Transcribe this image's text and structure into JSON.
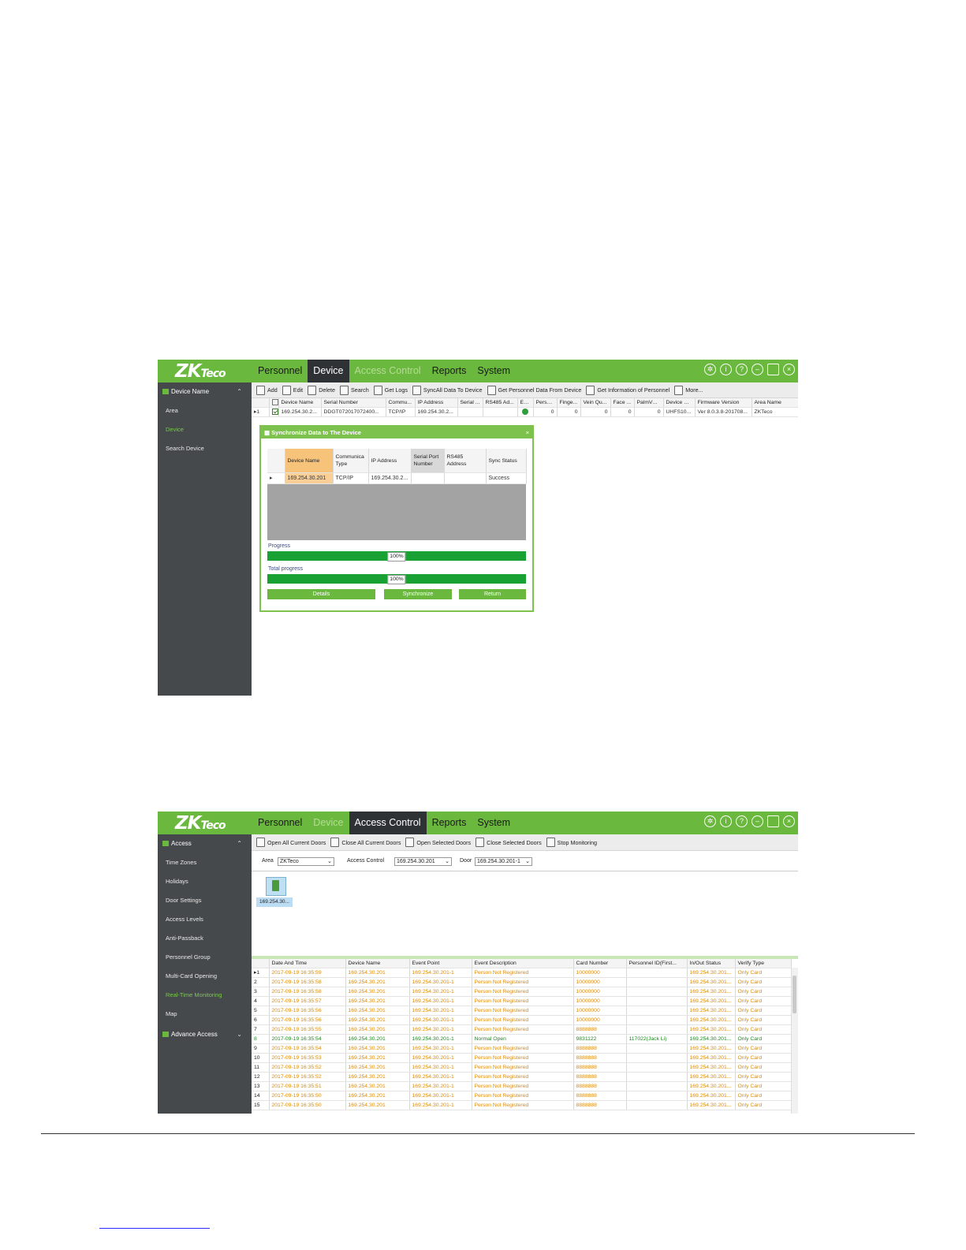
{
  "logo": "ZKTeco",
  "screen1": {
    "nav": [
      {
        "label": "Personnel",
        "state": "normal"
      },
      {
        "label": "Device",
        "state": "active"
      },
      {
        "label": "Access Control",
        "state": "muted"
      },
      {
        "label": "Reports",
        "state": "normal"
      },
      {
        "label": "System",
        "state": "normal"
      }
    ],
    "sidebar": {
      "section": "Device Name",
      "items": [
        {
          "label": "Area",
          "active": false
        },
        {
          "label": "Device",
          "active": true
        },
        {
          "label": "Search Device",
          "active": false
        }
      ]
    },
    "toolbar": [
      {
        "label": "Add",
        "icon": "add-icon"
      },
      {
        "label": "Edit",
        "icon": "edit-icon"
      },
      {
        "label": "Delete",
        "icon": "delete-icon"
      },
      {
        "label": "Search",
        "icon": "search-icon"
      },
      {
        "label": "Get Logs",
        "icon": "logs-icon"
      },
      {
        "label": "SyncAll Data To Device",
        "icon": "sync-icon"
      },
      {
        "label": "Get Personnel Data From Device",
        "icon": "download-icon"
      },
      {
        "label": "Get Information of Personnel",
        "icon": "person-icon"
      },
      {
        "label": "More...",
        "icon": "more-icon"
      }
    ],
    "device_table": {
      "headers": [
        "Device Name",
        "Serial Number",
        "Commu...",
        "IP Address",
        "Serial ...",
        "RS485 Ad...",
        "Ena...",
        "Perso...",
        "Finge...",
        "Vein Qu...",
        "Face ...",
        "PalmVei...",
        "Device M...",
        "Firmware Version",
        "Area Name"
      ],
      "rows": [
        {
          "index": "1",
          "cells": [
            "169.254.30.2...",
            "DDGT072017072400...",
            "TCP/IP",
            "169.254.30.2...",
            "",
            "",
            "",
            "0",
            "0",
            "0",
            "0",
            "0",
            "UHFS10...",
            "Ver 8.0.3.8-201708...",
            "ZKTeco"
          ]
        }
      ]
    },
    "dialog": {
      "title": "Synchronize Data to The Device",
      "close": "×",
      "headers": [
        "Device Name",
        "Communica Type",
        "IP Address",
        "Serial Port Number",
        "RS485 Address",
        "Sync Status"
      ],
      "rows": [
        [
          "169.254.30.201",
          "TCP/IP",
          "169.254.30.2...",
          "",
          "",
          "Success"
        ]
      ],
      "progress_label": "Progress",
      "progress_text": "100%",
      "progress_value": 1.0,
      "total_label": "Total progress",
      "total_text": "100%",
      "total_value": 1.0,
      "buttons": {
        "details": "Details",
        "synchronize": "Synchronize",
        "return": "Return"
      }
    }
  },
  "screen2": {
    "nav": [
      {
        "label": "Personnel",
        "state": "normal"
      },
      {
        "label": "Device",
        "state": "muted"
      },
      {
        "label": "Access Control",
        "state": "active"
      },
      {
        "label": "Reports",
        "state": "normal"
      },
      {
        "label": "System",
        "state": "normal"
      }
    ],
    "sidebar": {
      "section": "Access",
      "items": [
        {
          "label": "Time Zones",
          "active": false
        },
        {
          "label": "Holidays",
          "active": false
        },
        {
          "label": "Door Settings",
          "active": false
        },
        {
          "label": "Access Levels",
          "active": false
        },
        {
          "label": "Anti-Passback",
          "active": false
        },
        {
          "label": "Personnel Group",
          "active": false
        },
        {
          "label": "Multi-Card Opening",
          "active": false
        },
        {
          "label": "Real-Time Monitoring",
          "active": true
        },
        {
          "label": "Map",
          "active": false
        }
      ],
      "section2": "Advance Access"
    },
    "toolbar": [
      {
        "label": "Open All Current Doors",
        "icon": "door-open-icon"
      },
      {
        "label": "Close All Current Doors",
        "icon": "door-close-icon"
      },
      {
        "label": "Open Selected Doors",
        "icon": "door-open-icon"
      },
      {
        "label": "Close Selected Doors",
        "icon": "door-close-icon"
      },
      {
        "label": "Stop Monitoring",
        "icon": "monitor-icon"
      }
    ],
    "filter": {
      "area_label": "Area",
      "area_value": "ZKTeco",
      "access_label": "Access Control",
      "access_value": "169.254.30.201",
      "door_label": "Door",
      "door_value": "169.254.30.201-1"
    },
    "door_icon_label": "169.254.30...",
    "events": {
      "headers": [
        "Date And Time",
        "Device Name",
        "Event Point",
        "Event Description",
        "Card Number",
        "Personnel ID(First...",
        "In/Out Status",
        "Verify Type"
      ],
      "rows": [
        {
          "i": "1",
          "t": "2017-09-19 16:35:59",
          "d": "169.254.30.201",
          "p": "169.254.30.201-1",
          "e": "Person Not Registered",
          "c": "10000000",
          "pid": "",
          "s": "169.254.30.201...",
          "v": "Only Card",
          "g": false
        },
        {
          "i": "2",
          "t": "2017-09-19 16:35:58",
          "d": "169.254.30.201",
          "p": "169.254.30.201-1",
          "e": "Person Not Registered",
          "c": "10000000",
          "pid": "",
          "s": "169.254.30.201...",
          "v": "Only Card",
          "g": false
        },
        {
          "i": "3",
          "t": "2017-09-19 16:35:58",
          "d": "169.254.30.201",
          "p": "169.254.30.201-1",
          "e": "Person Not Registered",
          "c": "10000000",
          "pid": "",
          "s": "169.254.30.201...",
          "v": "Only Card",
          "g": false
        },
        {
          "i": "4",
          "t": "2017-09-19 16:35:57",
          "d": "169.254.30.201",
          "p": "169.254.30.201-1",
          "e": "Person Not Registered",
          "c": "10000000",
          "pid": "",
          "s": "169.254.30.201...",
          "v": "Only Card",
          "g": false
        },
        {
          "i": "5",
          "t": "2017-09-19 16:35:56",
          "d": "169.254.30.201",
          "p": "169.254.30.201-1",
          "e": "Person Not Registered",
          "c": "10000000",
          "pid": "",
          "s": "169.254.30.201...",
          "v": "Only Card",
          "g": false
        },
        {
          "i": "6",
          "t": "2017-09-19 16:35:56",
          "d": "169.254.30.201",
          "p": "169.254.30.201-1",
          "e": "Person Not Registered",
          "c": "10000000",
          "pid": "",
          "s": "169.254.30.201...",
          "v": "Only Card",
          "g": false
        },
        {
          "i": "7",
          "t": "2017-09-19 16:35:55",
          "d": "169.254.30.201",
          "p": "169.254.30.201-1",
          "e": "Person Not Registered",
          "c": "8888888",
          "pid": "",
          "s": "169.254.30.201...",
          "v": "Only Card",
          "g": false
        },
        {
          "i": "8",
          "t": "2017-09-19 16:35:54",
          "d": "169.254.30.201",
          "p": "169.254.30.201-1",
          "e": "Normal Open",
          "c": "9831122",
          "pid": "117022(Jack Li)",
          "s": "169.254.30.201...",
          "v": "Only Card",
          "g": true
        },
        {
          "i": "9",
          "t": "2017-09-19 16:35:54",
          "d": "169.254.30.201",
          "p": "169.254.30.201-1",
          "e": "Person Not Registered",
          "c": "8888888",
          "pid": "",
          "s": "169.254.30.201...",
          "v": "Only Card",
          "g": false
        },
        {
          "i": "10",
          "t": "2017-09-19 16:35:53",
          "d": "169.254.30.201",
          "p": "169.254.30.201-1",
          "e": "Person Not Registered",
          "c": "8888888",
          "pid": "",
          "s": "169.254.30.201...",
          "v": "Only Card",
          "g": false
        },
        {
          "i": "11",
          "t": "2017-09-19 16:35:52",
          "d": "169.254.30.201",
          "p": "169.254.30.201-1",
          "e": "Person Not Registered",
          "c": "8888888",
          "pid": "",
          "s": "169.254.30.201...",
          "v": "Only Card",
          "g": false
        },
        {
          "i": "12",
          "t": "2017-09-19 16:35:52",
          "d": "169.254.30.201",
          "p": "169.254.30.201-1",
          "e": "Person Not Registered",
          "c": "8888888",
          "pid": "",
          "s": "169.254.30.201...",
          "v": "Only Card",
          "g": false
        },
        {
          "i": "13",
          "t": "2017-09-19 16:35:51",
          "d": "169.254.30.201",
          "p": "169.254.30.201-1",
          "e": "Person Not Registered",
          "c": "8888888",
          "pid": "",
          "s": "169.254.30.201...",
          "v": "Only Card",
          "g": false
        },
        {
          "i": "14",
          "t": "2017-09-19 16:35:50",
          "d": "169.254.30.201",
          "p": "169.254.30.201-1",
          "e": "Person Not Registered",
          "c": "8888888",
          "pid": "",
          "s": "169.254.30.201...",
          "v": "Only Card",
          "g": false
        },
        {
          "i": "15",
          "t": "2017-09-19 16:35:50",
          "d": "169.254.30.201",
          "p": "169.254.30.201-1",
          "e": "Person Not Registered",
          "c": "8888888",
          "pid": "",
          "s": "169.254.30.201...",
          "v": "Only Card",
          "g": false
        }
      ]
    }
  },
  "colors": {
    "brand_green": "#6ab83e",
    "sidebar": "#45494c",
    "event_orange": "#e08a00",
    "event_green": "#1f8a1f",
    "progress_green": "#1aa134"
  }
}
